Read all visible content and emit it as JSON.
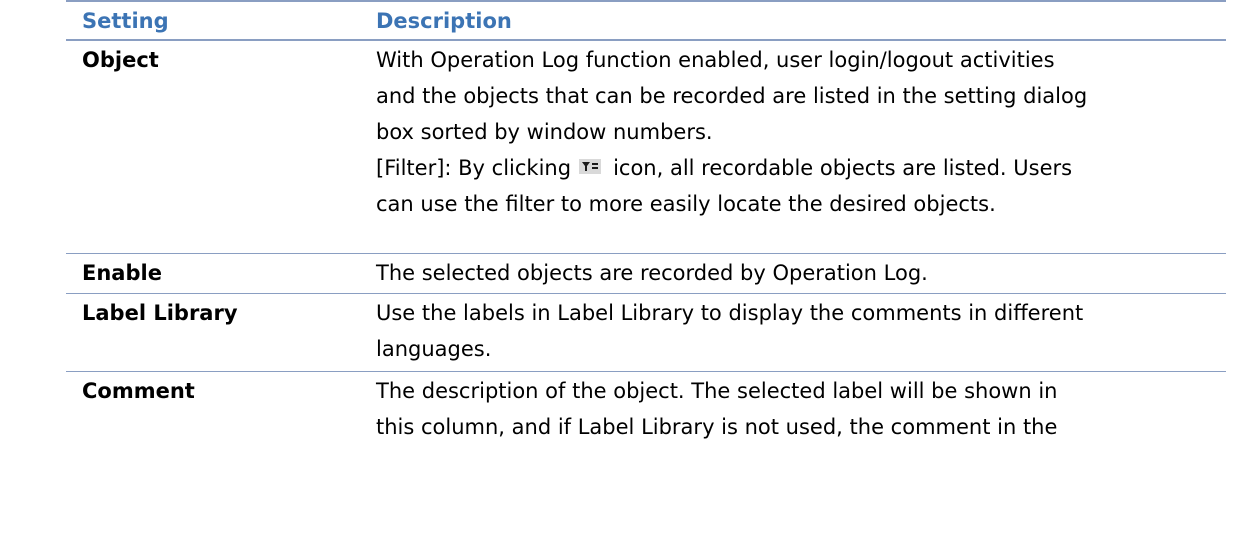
{
  "table": {
    "header": {
      "setting": "Setting",
      "description": "Description"
    },
    "rows": [
      {
        "setting": "Object",
        "description_lines": [
          "With Operation Log function enabled, user login/logout activities",
          "and the objects that can be recorded are listed in the setting dialog",
          "box sorted by window numbers."
        ],
        "filter_prefix": "[Filter]: By clicking",
        "filter_icon": "filter-icon",
        "filter_suffix": "icon, all recordable objects are listed. Users",
        "filter_line2": "can use the filter to more easily locate the desired objects."
      },
      {
        "setting": "Enable",
        "description_lines": [
          "The selected objects are recorded by Operation Log."
        ]
      },
      {
        "setting": "Label Library",
        "description_lines": [
          "Use the labels in Label Library to display the comments in different",
          "languages."
        ]
      },
      {
        "setting": "Comment",
        "description_lines": [
          "The description of the object. The selected label will be shown in",
          "this column, and if Label Library is not used, the comment in the"
        ]
      }
    ]
  },
  "colors": {
    "header_text": "#3c74b4",
    "rule": "#8a9ec2",
    "icon_bg": "#d9d9d9"
  }
}
